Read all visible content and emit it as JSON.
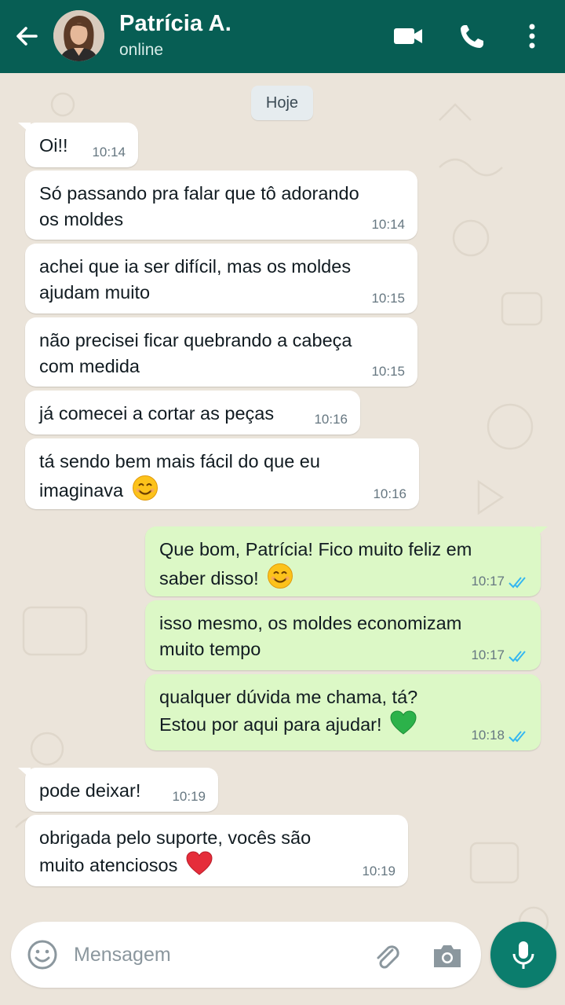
{
  "header": {
    "contact_name": "Patrícia A.",
    "status": "online",
    "icons": [
      "back-arrow-icon",
      "avatar",
      "video-call-icon",
      "phone-icon",
      "more-vert-icon"
    ],
    "bg_color": "#075e54"
  },
  "chat": {
    "date_label": "Hoje",
    "messages": [
      {
        "dir": "in",
        "text": [
          "Oi!!"
        ],
        "time": "10:14"
      },
      {
        "dir": "in",
        "text": [
          "Só passando pra falar que tô adorando",
          "os moldes"
        ],
        "time": "10:14"
      },
      {
        "dir": "in",
        "text": [
          "achei que ia ser difícil, mas os moldes",
          "ajudam muito"
        ],
        "time": "10:15"
      },
      {
        "dir": "in",
        "text": [
          "não precisei ficar quebrando a cabeça",
          "com medida"
        ],
        "time": "10:15"
      },
      {
        "dir": "in",
        "text": [
          "já comecei a cortar as peças"
        ],
        "time": "10:16"
      },
      {
        "dir": "in",
        "text": [
          "tá sendo bem mais fácil do que eu",
          "imaginava"
        ],
        "emoji": "smiling-face",
        "time": "10:16"
      },
      {
        "dir": "out",
        "text": [
          "Que bom, Patrícia! Fico muito feliz em",
          "saber disso!"
        ],
        "emoji": "smiling-face",
        "time": "10:17",
        "status": "read"
      },
      {
        "dir": "out",
        "text": [
          "isso mesmo, os moldes economizam",
          "muito tempo"
        ],
        "time": "10:17",
        "status": "read"
      },
      {
        "dir": "out",
        "text": [
          "qualquer dúvida me chama, tá?",
          "Estou por aqui para ajudar!"
        ],
        "emoji": "green-heart",
        "time": "10:18",
        "status": "read"
      },
      {
        "dir": "in",
        "text": [
          "pode deixar!"
        ],
        "time": "10:19"
      },
      {
        "dir": "in",
        "text": [
          "obrigada pelo suporte, vocês são",
          "muito atenciosos"
        ],
        "emoji": "red-heart",
        "time": "10:19"
      }
    ],
    "colors": {
      "incoming": "#ffffff",
      "outgoing": "#dcf8c6",
      "read_tick": "#34b7f1"
    }
  },
  "composer": {
    "placeholder": "Mensagem",
    "icons": [
      "emoji-icon",
      "attach-icon",
      "camera-icon",
      "mic-icon"
    ],
    "mic_color": "#0b7d6d"
  }
}
